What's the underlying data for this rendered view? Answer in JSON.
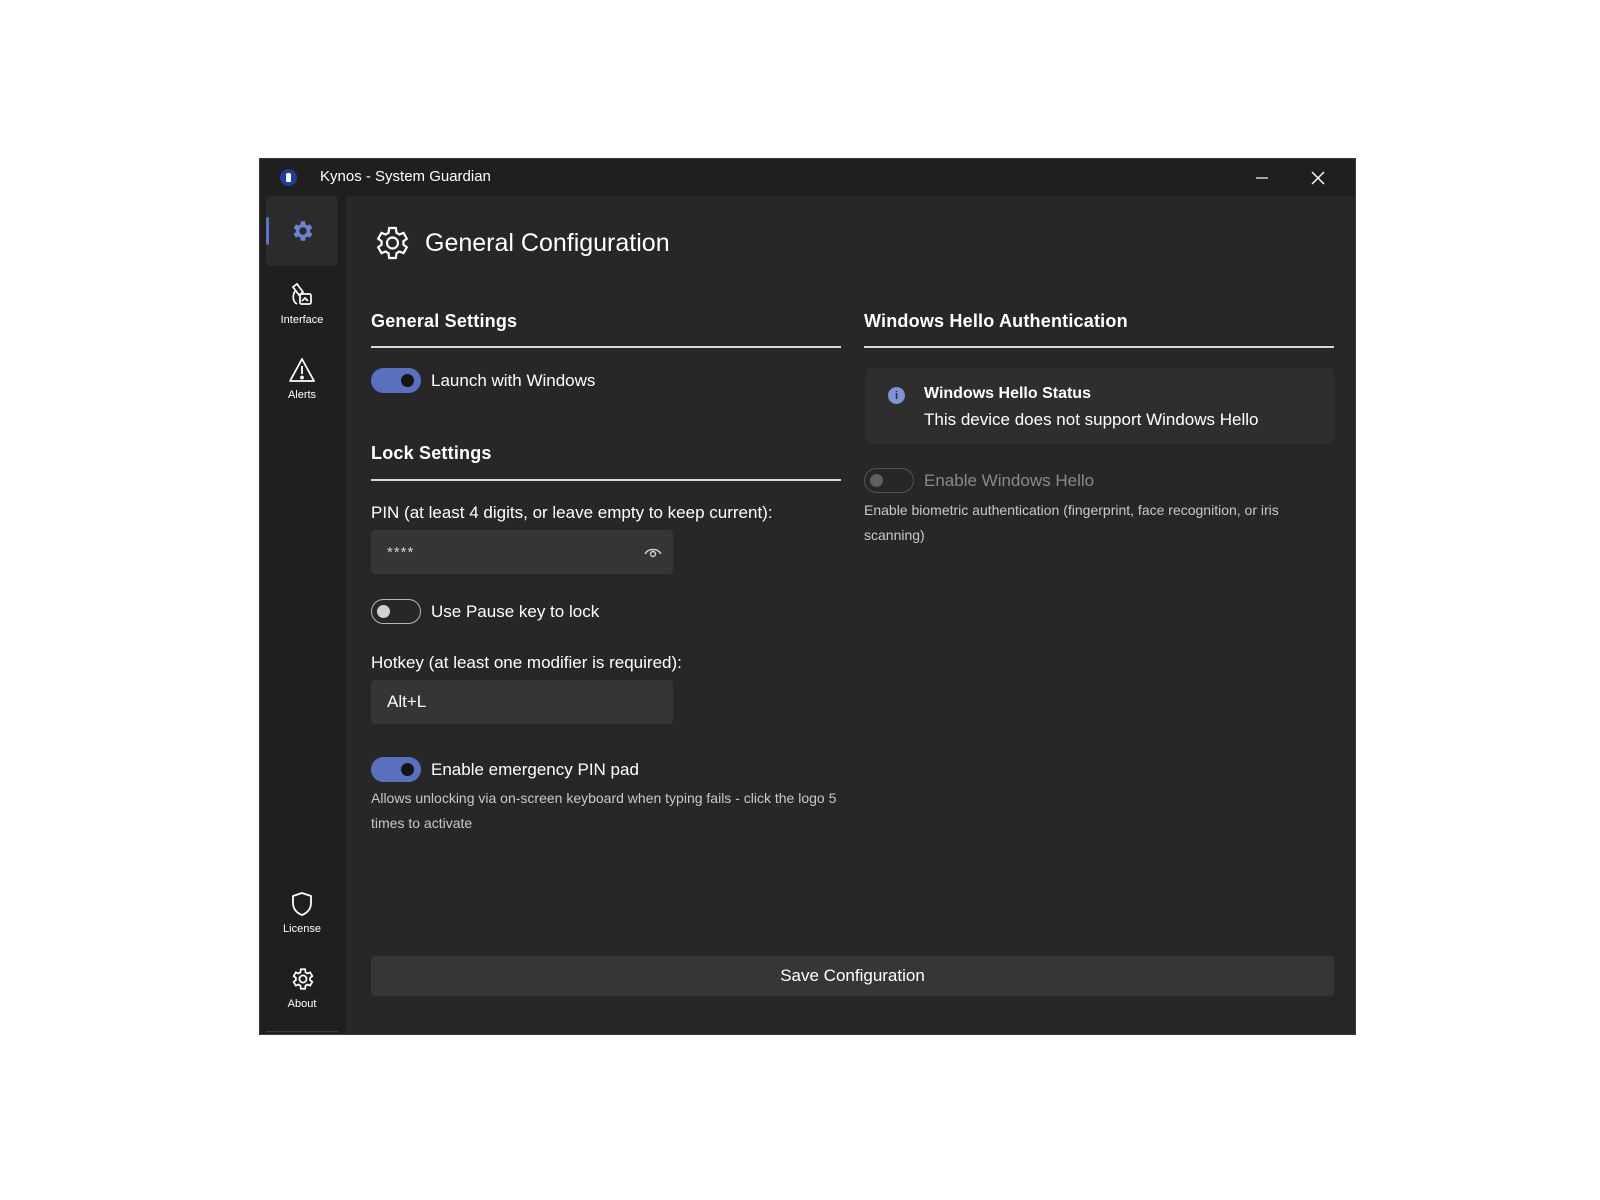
{
  "window": {
    "title": "Kynos - System Guardian"
  },
  "sidebar": {
    "items": [
      {
        "icon": "gear-icon",
        "label": "",
        "active": true
      },
      {
        "icon": "palette-icon",
        "label": "Interface"
      },
      {
        "icon": "warning-icon",
        "label": "Alerts"
      }
    ],
    "bottom_items": [
      {
        "icon": "shield-icon",
        "label": "License"
      },
      {
        "icon": "gear-icon",
        "label": "About"
      }
    ]
  },
  "page": {
    "title": "General Configuration",
    "icon": "gear-icon"
  },
  "general_settings": {
    "title": "General Settings",
    "launch_with_windows": {
      "label": "Launch with Windows",
      "on": true
    }
  },
  "lock_settings": {
    "title": "Lock Settings",
    "pin_label": "PIN (at least 4 digits, or leave empty to keep current):",
    "pin_value": "****",
    "pause_key": {
      "label": "Use Pause key to lock",
      "on": false
    },
    "hotkey_label": "Hotkey (at least one modifier is required):",
    "hotkey_value": "Alt+L",
    "emergency_pad": {
      "label": "Enable emergency PIN pad",
      "on": true
    },
    "emergency_help": "Allows unlocking via on-screen keyboard when typing fails - click the logo 5 times to activate"
  },
  "windows_hello": {
    "title": "Windows Hello Authentication",
    "status_title": "Windows Hello Status",
    "status_message": "This device does not support Windows Hello",
    "enable": {
      "label": "Enable Windows Hello",
      "on": false,
      "disabled": true
    },
    "help": "Enable biometric authentication (fingerprint, face recognition, or iris scanning)"
  },
  "actions": {
    "save_label": "Save Configuration"
  },
  "colors": {
    "accent": "#5b6fbf",
    "background": "#272727",
    "sidebar": "#1f1f1f"
  }
}
